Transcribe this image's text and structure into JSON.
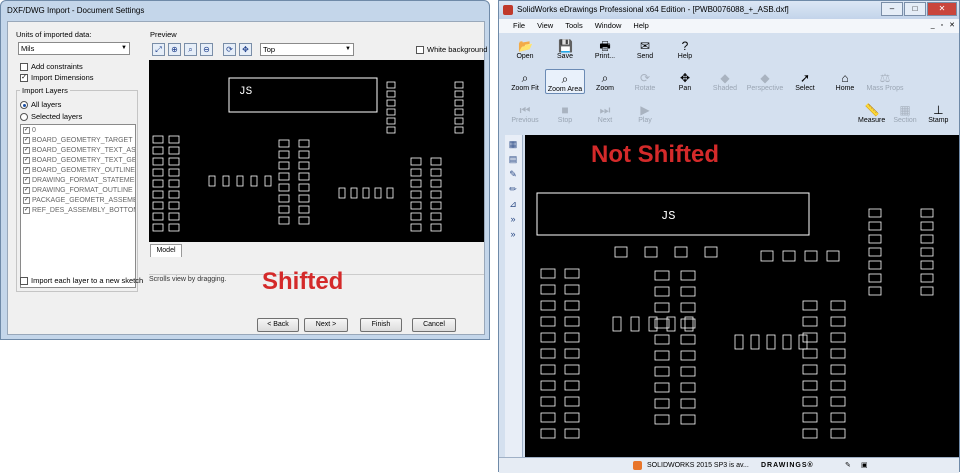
{
  "import_dialog": {
    "title": "DXF/DWG Import - Document Settings",
    "units_label": "Units of imported data:",
    "units_value": "Mils",
    "add_constraints": "Add constraints",
    "import_dimensions": "Import Dimensions",
    "import_layers_label": "Import Layers",
    "all_layers": "All layers",
    "selected_layers": "Selected layers",
    "layers": [
      "0",
      "BOARD_GEOMETRY_TARGET",
      "BOARD_GEOMETRY_TEXT_ASB",
      "BOARD_GEOMETRY_TEXT_GER",
      "BOARD_GEOMETRY_OUTLINE",
      "DRAWING_FORMAT_STATEMEN",
      "DRAWING_FORMAT_OUTLINE",
      "PACKAGE_GEOMETR_ASSEMBL",
      "REF_DES_ASSEMBLY_BOTTOM"
    ],
    "import_each_layer": "Import each layer to a new sketch",
    "preview_label": "Preview",
    "view_value": "Top",
    "white_background": "White background",
    "preview_text": "JS",
    "model_tab": "Model",
    "status_text": "Scrolls view by dragging.",
    "buttons": {
      "back": "< Back",
      "next": "Next >",
      "finish": "Finish",
      "cancel": "Cancel"
    },
    "shifted_annotation": "Shifted"
  },
  "edrawings": {
    "title": "SolidWorks eDrawings Professional x64 Edition - [PWB0076088_+_ASB.dxf]",
    "menu": [
      "File",
      "View",
      "Tools",
      "Window",
      "Help"
    ],
    "toolbar1": [
      {
        "label": "Open",
        "icon": "open-folder-icon",
        "glyph": "📂"
      },
      {
        "label": "Save",
        "icon": "save-icon",
        "glyph": "💾"
      },
      {
        "label": "Print...",
        "icon": "print-icon",
        "glyph": "🖶"
      },
      {
        "label": "Send",
        "icon": "send-icon",
        "glyph": "✉"
      },
      {
        "label": "Help",
        "icon": "help-icon",
        "glyph": "?"
      }
    ],
    "toolbar2": [
      {
        "label": "Zoom Fit",
        "icon": "zoom-fit-icon",
        "glyph": "⌕",
        "state": "on"
      },
      {
        "label": "Zoom Area",
        "icon": "zoom-area-icon",
        "glyph": "⌕",
        "state": "active"
      },
      {
        "label": "Zoom",
        "icon": "zoom-icon",
        "glyph": "⌕",
        "state": "on"
      },
      {
        "label": "Rotate",
        "icon": "rotate-icon",
        "glyph": "⟳",
        "state": "off"
      },
      {
        "label": "Pan",
        "icon": "pan-icon",
        "glyph": "✥",
        "state": "on"
      },
      {
        "label": "Shaded",
        "icon": "shaded-icon",
        "glyph": "◆",
        "state": "off"
      },
      {
        "label": "Perspective",
        "icon": "perspective-icon",
        "glyph": "◆",
        "state": "off"
      },
      {
        "label": "Select",
        "icon": "select-arrow-icon",
        "glyph": "➚",
        "state": "on"
      },
      {
        "label": "Home",
        "icon": "home-icon",
        "glyph": "⌂",
        "state": "on"
      },
      {
        "label": "Mass Props",
        "icon": "mass-props-icon",
        "glyph": "⚖",
        "state": "off"
      }
    ],
    "toolbar3": [
      {
        "label": "Previous",
        "icon": "previous-icon",
        "glyph": "⏮",
        "state": "off"
      },
      {
        "label": "Stop",
        "icon": "stop-icon",
        "glyph": "■",
        "state": "off"
      },
      {
        "label": "Next",
        "icon": "next-icon",
        "glyph": "⏭",
        "state": "off"
      },
      {
        "label": "Play",
        "icon": "play-icon",
        "glyph": "▶",
        "state": "off"
      }
    ],
    "toolbar3_right": [
      {
        "label": "Measure",
        "icon": "measure-icon",
        "glyph": "📏",
        "state": "on"
      },
      {
        "label": "Section",
        "icon": "section-icon",
        "glyph": "▦",
        "state": "off"
      },
      {
        "label": "Stamp",
        "icon": "stamp-icon",
        "glyph": "⊥",
        "state": "on"
      }
    ],
    "view_text": "JS",
    "not_shifted_annotation": "Not Shifted",
    "status_text": "SOLIDWORKS 2015 SP3 is av...",
    "brand": "DRAWINGS®"
  },
  "colors": {
    "annotation": "#d42a2a",
    "cad_bg": "#000000",
    "cad_lines": "#ffffff"
  }
}
